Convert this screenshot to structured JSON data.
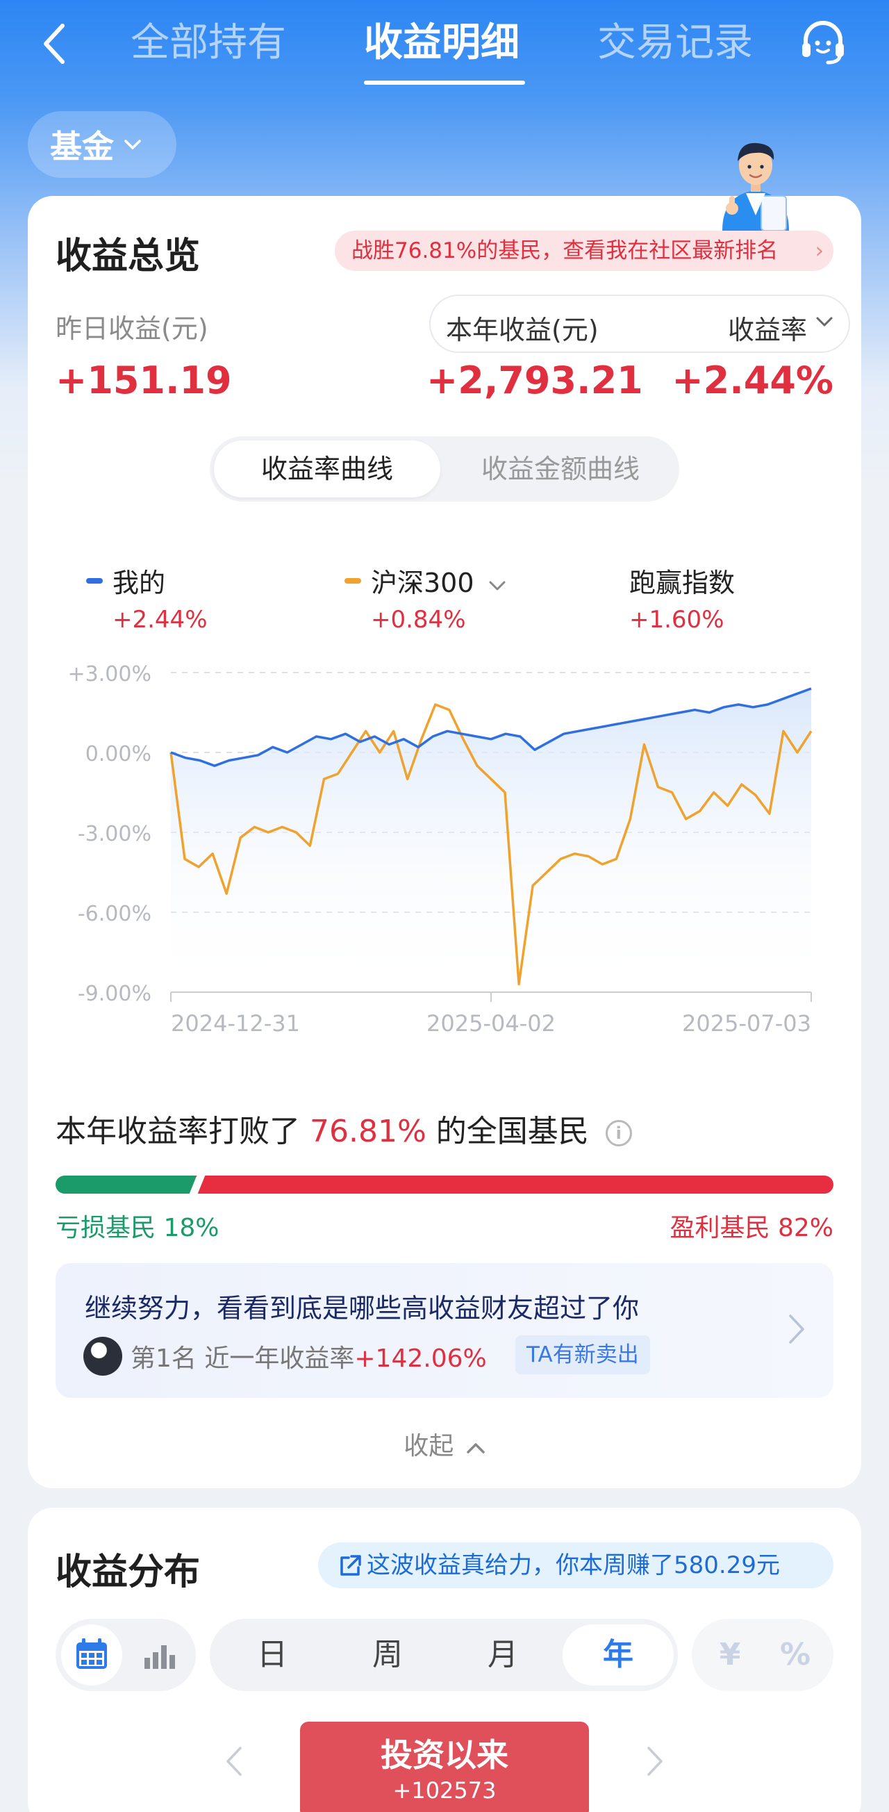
{
  "nav": {
    "tabs": [
      "全部持有",
      "收益明细",
      "交易记录"
    ],
    "active_tab": "收益明细"
  },
  "filter": {
    "label": "基金"
  },
  "overview": {
    "title": "收益总览",
    "rank_text": "战胜76.81%的基民，查看我在社区最新排名",
    "yesterday_label": "昨日收益(元)",
    "yesterday_value": "+151.19",
    "year_label": "本年收益(元)",
    "rate_label": "收益率",
    "year_value": "+2,793.21",
    "rate_value": "+2.44%",
    "curve_tabs": {
      "active": "收益率曲线",
      "inactive": "收益金额曲线"
    }
  },
  "legend": [
    {
      "name": "我的",
      "value": "+2.44%",
      "color": "#2f6fe0"
    },
    {
      "name": "沪深300",
      "value": "+0.84%",
      "color": "#f0a22e"
    },
    {
      "name": "跑赢指数",
      "value": "+1.60%"
    }
  ],
  "chart_data": {
    "type": "line",
    "yticks": [
      "+3.00%",
      "0.00%",
      "-3.00%",
      "-6.00%",
      "-9.00%"
    ],
    "ylim": [
      -9,
      3
    ],
    "xticks": [
      "2024-12-31",
      "2025-04-02",
      "2025-07-03"
    ],
    "series": [
      {
        "name": "我的",
        "color": "#2f6fe0",
        "values": [
          0.0,
          -0.2,
          -0.3,
          -0.5,
          -0.3,
          -0.2,
          -0.1,
          0.2,
          0.0,
          0.3,
          0.6,
          0.5,
          0.7,
          0.4,
          0.6,
          0.3,
          0.5,
          0.2,
          0.6,
          0.8,
          0.7,
          0.6,
          0.5,
          0.7,
          0.6,
          0.1,
          0.4,
          0.7,
          0.8,
          0.9,
          1.0,
          1.1,
          1.2,
          1.3,
          1.4,
          1.5,
          1.6,
          1.5,
          1.7,
          1.8,
          1.7,
          1.8,
          2.0,
          2.2,
          2.4
        ]
      },
      {
        "name": "沪深300",
        "color": "#f0a22e",
        "values": [
          0.0,
          -4.0,
          -4.3,
          -3.8,
          -5.3,
          -3.2,
          -2.8,
          -3.0,
          -2.8,
          -3.0,
          -3.5,
          -1.0,
          -0.8,
          0.0,
          0.8,
          0.0,
          0.8,
          -1.0,
          0.5,
          1.8,
          1.6,
          0.5,
          -0.5,
          -1.0,
          -1.5,
          -8.7,
          -5.0,
          -4.5,
          -4.0,
          -3.8,
          -3.9,
          -4.2,
          -4.0,
          -2.5,
          0.3,
          -1.3,
          -1.5,
          -2.5,
          -2.2,
          -1.5,
          -2.0,
          -1.2,
          -1.6,
          -2.3,
          0.8,
          0.0,
          0.8
        ]
      }
    ]
  },
  "beat": {
    "prefix": "本年收益率打败了",
    "percent": "76.81%",
    "suffix": "的全国基民",
    "loss_label": "亏损基民 18%",
    "gain_label": "盈利基民 82%",
    "loss_share": 0.18
  },
  "promo": {
    "title": "继续努力，看看到底是哪些高收益财友超过了你",
    "rank": "第1名",
    "desc": "近一年收益率",
    "value": "+142.06%",
    "tag": "TA有新卖出"
  },
  "collapse_label": "收起",
  "distribution": {
    "title": "收益分布",
    "tip": "这波收益真给力，你本周赚了580.29元",
    "periods": [
      "日",
      "周",
      "月",
      "年"
    ],
    "active_period": "年",
    "units": [
      "¥",
      "%"
    ],
    "since_label": "投资以来",
    "since_value": "+102573"
  }
}
